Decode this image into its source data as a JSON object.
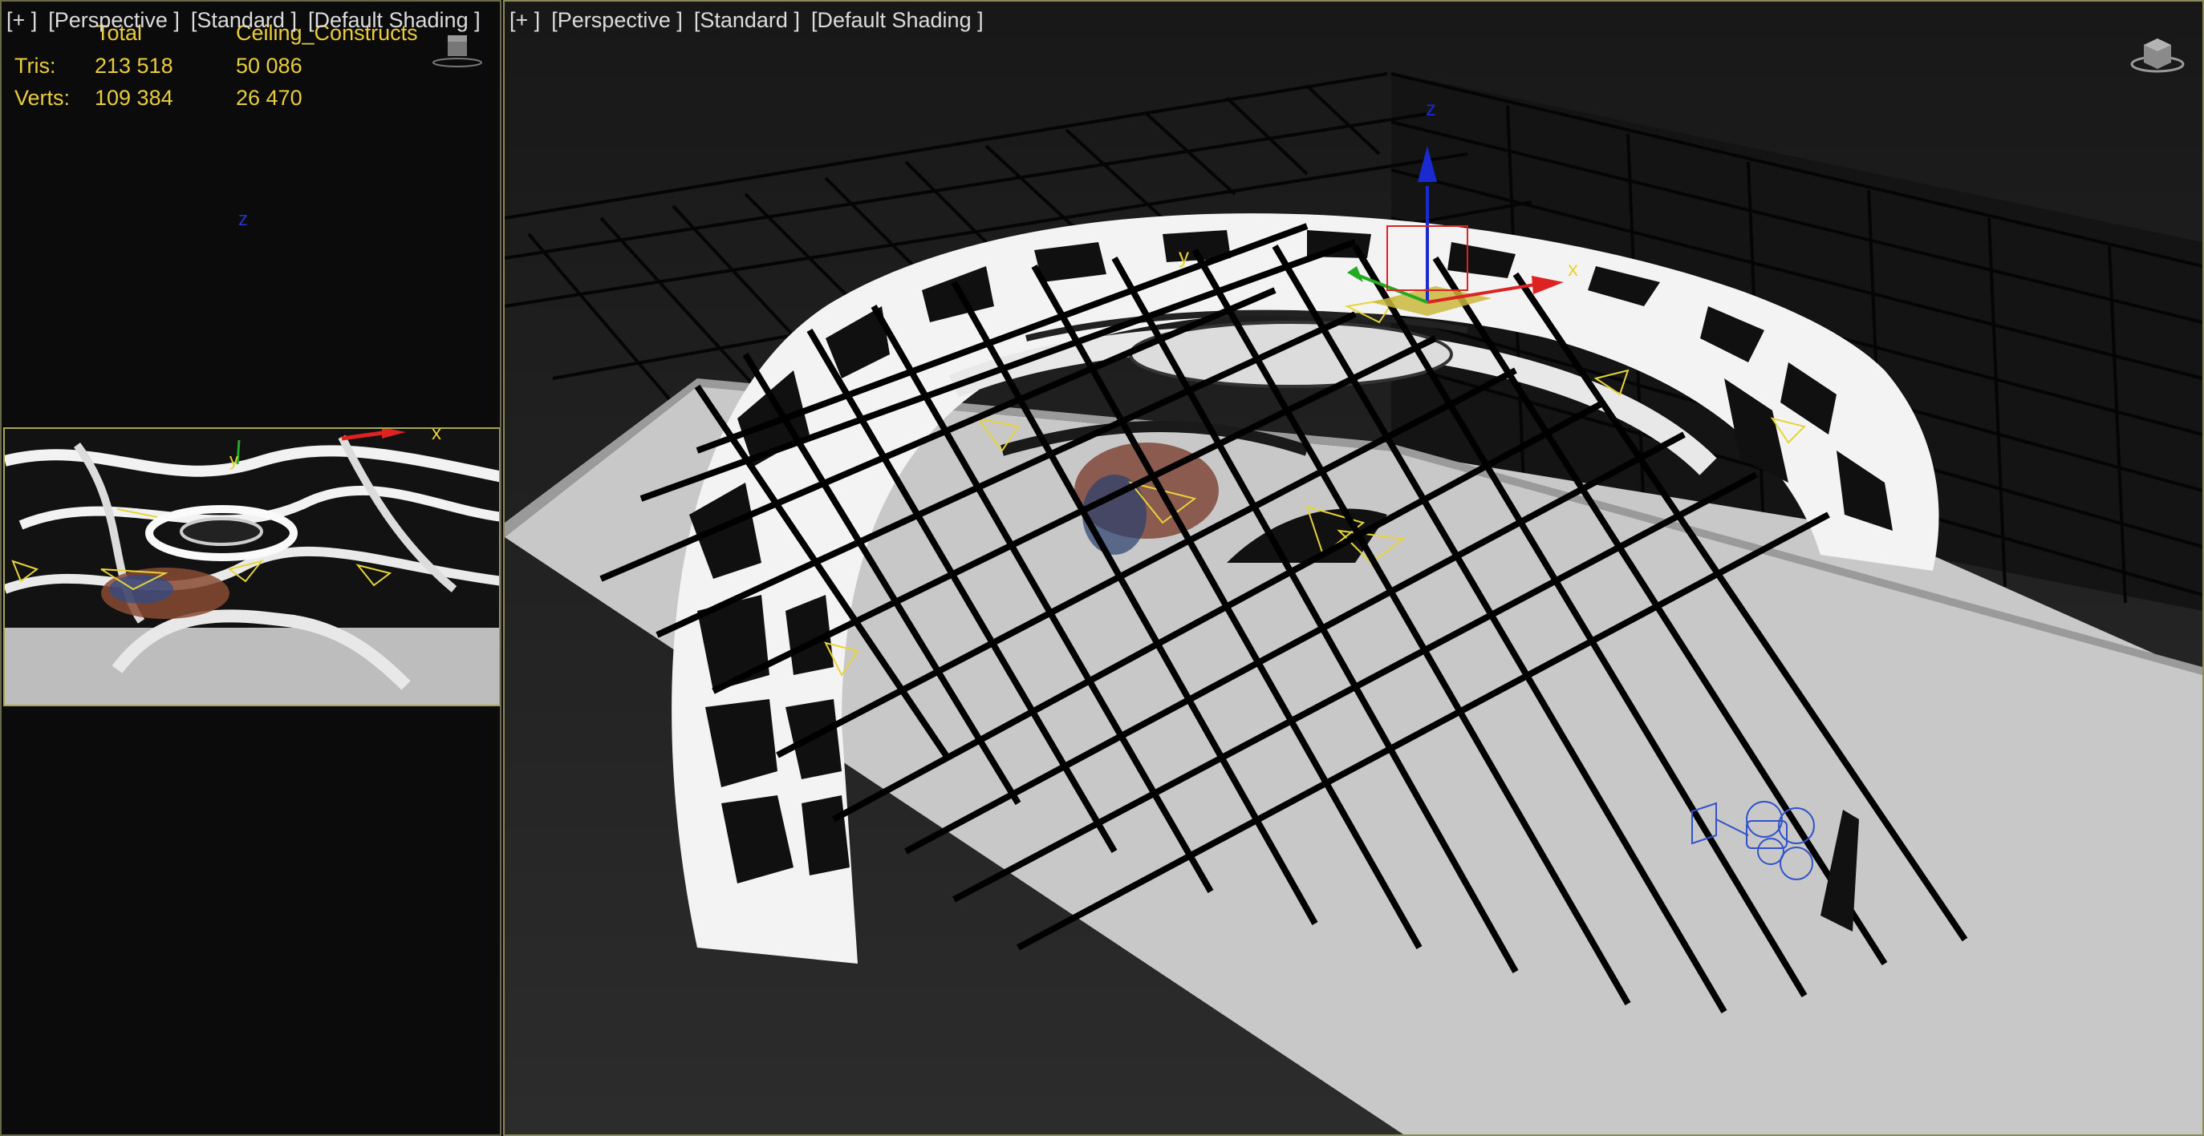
{
  "left_viewport": {
    "label": {
      "plus": "[+ ]",
      "view": "[Perspective ]",
      "style": "[Standard ]",
      "shading": "[Default Shading ]"
    },
    "stats": {
      "header_total": "Total",
      "header_object": "Ceiling_Constructs",
      "rows": [
        {
          "label": "Tris:",
          "total": "213 518",
          "object": "50 086"
        },
        {
          "label": "Verts:",
          "total": "109 384",
          "object": "26 470"
        }
      ]
    },
    "axis_z": "z",
    "inset_axes": {
      "x": "x",
      "y": "y"
    }
  },
  "main_viewport": {
    "label": {
      "plus": "[+ ]",
      "view": "[Perspective ]",
      "style": "[Standard ]",
      "shading": "[Default Shading ]"
    },
    "gizmo": {
      "x": "x",
      "y": "y",
      "z": "z"
    }
  },
  "colors": {
    "stats_text": "#e8cc3c",
    "label_text": "#dcdcdc",
    "axis_x": "#dd2222",
    "axis_y": "#22aa22",
    "axis_z": "#1a2ad0",
    "active_border": "#8a8a5a"
  },
  "icons": [
    "viewcube-icon",
    "camera-icon",
    "transform-gizmo-icon"
  ]
}
